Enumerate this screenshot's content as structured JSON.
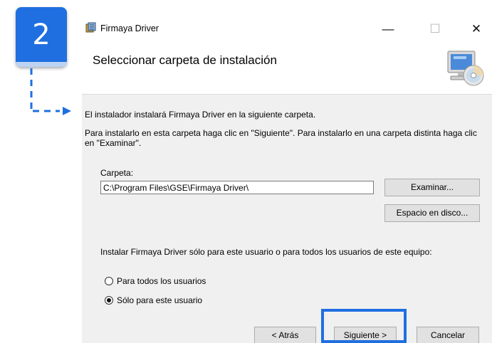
{
  "step_badge": {
    "number": "2"
  },
  "window": {
    "title": "Firmaya Driver",
    "controls": {
      "minimize": "—",
      "maximize": "☐",
      "close": "✕"
    }
  },
  "header": {
    "title": "Seleccionar carpeta de instalación",
    "icon": "computer-cd-icon"
  },
  "body": {
    "intro": "El instalador instalará Firmaya Driver en la siguiente carpeta.",
    "instructions": "Para instalarlo en esta carpeta haga clic en \"Siguiente\". Para instalarlo en una carpeta distinta haga clic en \"Examinar\".",
    "folder_label": "Carpeta:",
    "folder_path": "C:\\Program Files\\GSE\\Firmaya Driver\\",
    "browse_button": "Examinar...",
    "disk_space_button": "Espacio en disco...",
    "scope_question": "Instalar Firmaya Driver sólo para este usuario o para todos los usuarios de este equipo:",
    "radio_options": [
      {
        "label": "Para todos los usuarios",
        "selected": false
      },
      {
        "label": "Sólo para este usuario",
        "selected": true
      }
    ]
  },
  "footer": {
    "back_button": "< Atrás",
    "next_button": "Siguiente >",
    "cancel_button": "Cancelar"
  },
  "colors": {
    "accent": "#1f6fe0",
    "dialog_body": "#f0f0f0",
    "button_face": "#e1e1e1"
  }
}
